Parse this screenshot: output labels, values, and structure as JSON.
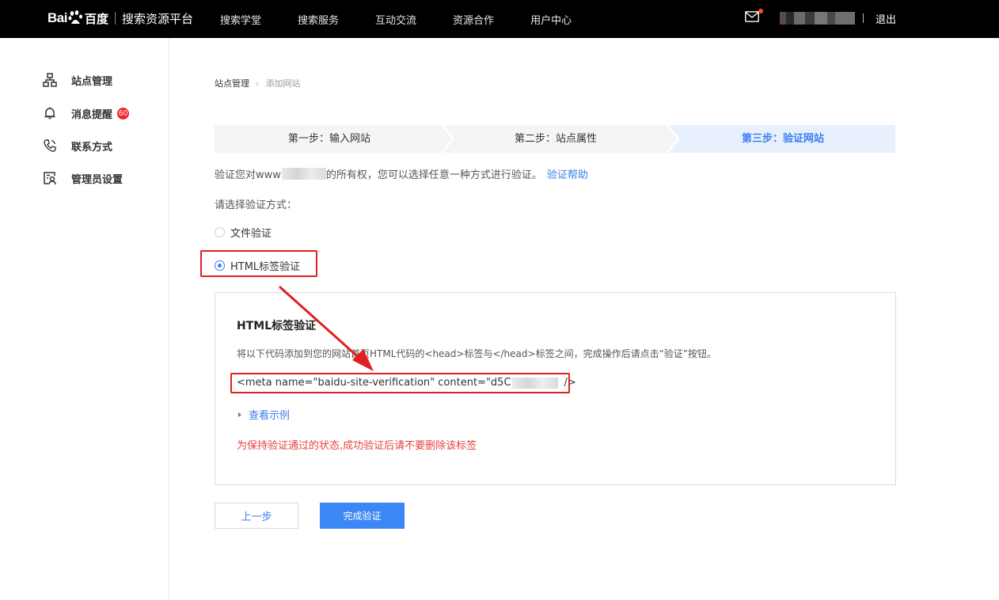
{
  "header": {
    "logo_bai": "Bai",
    "logo_cn": "百度",
    "platform": "搜索资源平台",
    "nav": [
      "搜索学堂",
      "搜索服务",
      "互动交流",
      "资源合作",
      "用户中心"
    ],
    "logout": "退出"
  },
  "sidebar": {
    "items": [
      {
        "label": "站点管理",
        "icon": "sitemap-icon"
      },
      {
        "label": "消息提醒",
        "icon": "bell-icon",
        "badge": "60"
      },
      {
        "label": "联系方式",
        "icon": "phone-icon"
      },
      {
        "label": "管理员设置",
        "icon": "admin-icon"
      }
    ]
  },
  "breadcrumb": {
    "parent": "站点管理",
    "current": "添加网站"
  },
  "steps": [
    {
      "label": "第一步：输入网站",
      "active": false
    },
    {
      "label": "第二步：站点属性",
      "active": false
    },
    {
      "label": "第三步：验证网站",
      "active": true
    }
  ],
  "intro": {
    "prefix": "验证您对www",
    "suffix": "的所有权，您可以选择任意一种方式进行验证。",
    "help_link": "验证帮助"
  },
  "choose_label": "请选择验证方式：",
  "methods": [
    {
      "label": "文件验证",
      "checked": false
    },
    {
      "label": "HTML标签验证",
      "checked": true
    }
  ],
  "panel": {
    "title": "HTML标签验证",
    "description": "将以下代码添加到您的网站首页HTML代码的<head>标签与</head>标签之间，完成操作后请点击“验证”按钮。",
    "code_prefix": "<meta name=\"baidu-site-verification\" content=\"d5C",
    "code_suffix": "/>",
    "example_link": "查看示例",
    "warning": "为保持验证通过的状态,成功验证后请不要删除该标签"
  },
  "buttons": {
    "prev": "上一步",
    "done": "完成验证"
  },
  "colors": {
    "accent": "#3a7ef0",
    "annotation": "#e02020",
    "warning": "#e64340",
    "topbar": "#000000"
  }
}
